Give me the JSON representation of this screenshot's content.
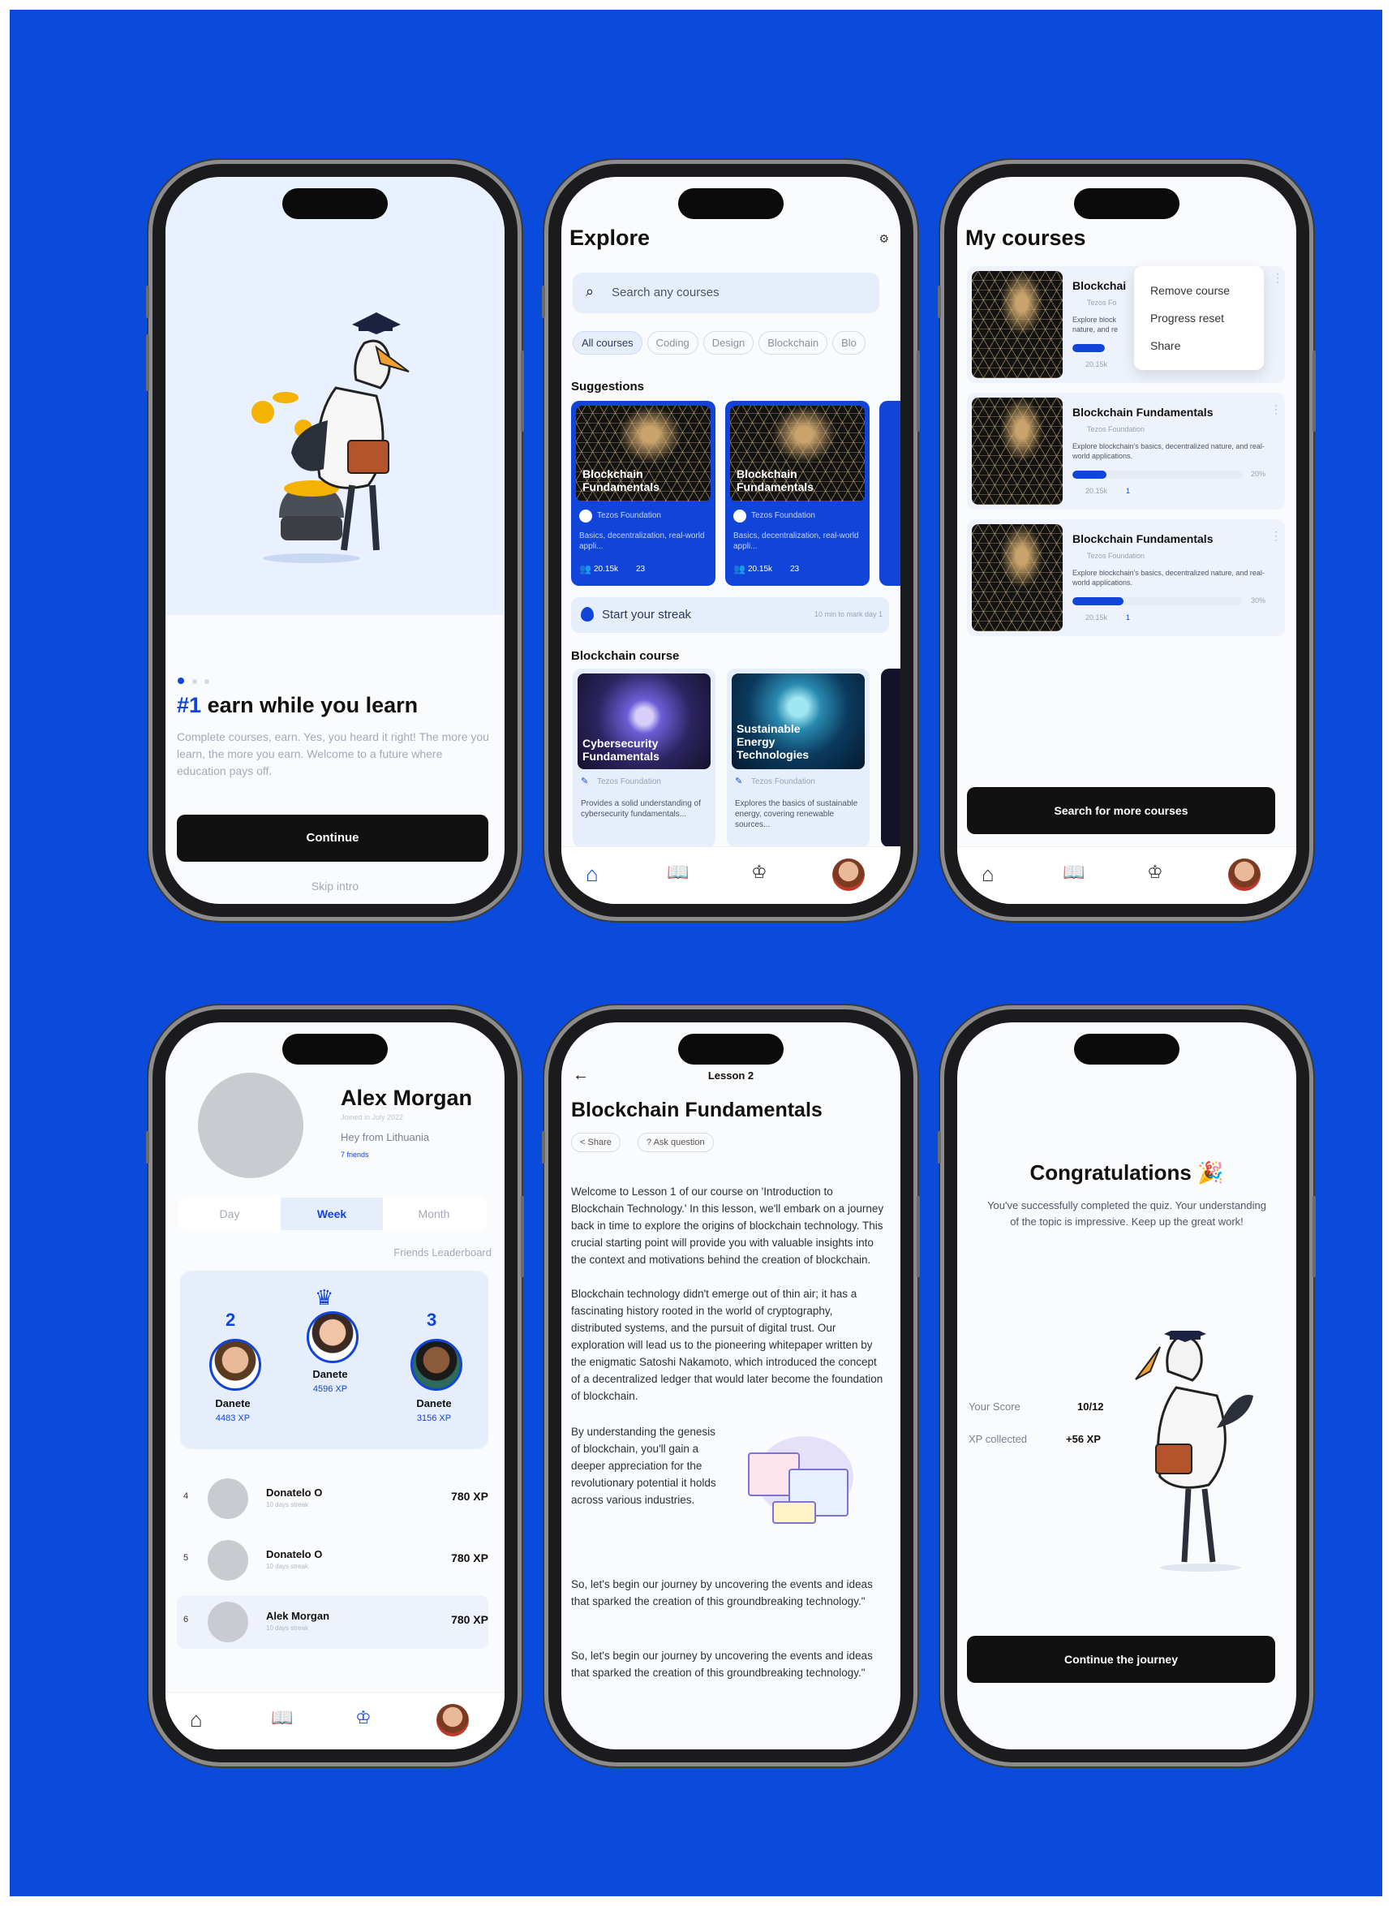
{
  "colors": {
    "background": "#0a4bdc",
    "accent": "#1145d9",
    "dark": "#111111"
  },
  "onboarding": {
    "headline_hash": "#1",
    "headline": "earn while you learn",
    "body": "Complete courses, earn. Yes, you heard it right! The more you learn, the more you earn. Welcome to a future where education pays off.",
    "continue_label": "Continue",
    "skip_label": "Skip intro"
  },
  "explore": {
    "title": "Explore",
    "search_placeholder": "Search any courses",
    "filters": [
      "All courses",
      "Coding",
      "Design",
      "Blockchain",
      "Blo"
    ],
    "suggestions_label": "Suggestions",
    "suggestion_cards": [
      {
        "title": "Blockchain Fundamentals",
        "org": "Tezos Foundation",
        "desc": "Basics, decentralization, real-world appli...",
        "learners": "20.15k",
        "count": "23"
      },
      {
        "title": "Blockchain Fundamentals",
        "org": "Tezos Foundation",
        "desc": "Basics, decentralization, real-world appli...",
        "learners": "20.15k",
        "count": "23"
      }
    ],
    "streak_label": "Start your streak",
    "streak_note": "10 min to mark day 1",
    "blockchain_course_label": "Blockchain course",
    "course_cards": [
      {
        "title": "Cybersecurity Fundamentals",
        "org": "Tezos Foundation",
        "desc": "Provides a solid understanding of cybersecurity fundamentals..."
      },
      {
        "title": "Sustainable Energy Technologies",
        "org": "Tezos Foundation",
        "desc": "Explores the basics of sustainable energy, covering renewable sources..."
      }
    ]
  },
  "my_courses": {
    "title": "My courses",
    "courses": [
      {
        "title": "Blockchai",
        "org": "Tezos Fo",
        "desc": "Explore block nature, and re",
        "progress_pct": 20,
        "pct_label": "",
        "learners": "20.15k",
        "count": "1"
      },
      {
        "title": "Blockchain Fundamentals",
        "org": "Tezos Foundation",
        "desc": "Explore blockchain's basics, decentralized nature, and real-world applications.",
        "progress_pct": 20,
        "pct_label": "20%",
        "learners": "20.15k",
        "count": "1"
      },
      {
        "title": "Blockchain Fundamentals",
        "org": "Tezos Foundation",
        "desc": "Explore blockchain's basics, decentralized nature, and real-world applications.",
        "progress_pct": 30,
        "pct_label": "30%",
        "learners": "20.15k",
        "count": "1"
      }
    ],
    "menu": [
      "Remove course",
      "Progress reset",
      "Share"
    ],
    "cta_label": "Search for more courses"
  },
  "profile": {
    "name": "Alex Morgan",
    "joined": "Joined in July 2022",
    "bio": "Hey from Lithuania",
    "friends": "7 friends",
    "tabs": [
      "Day",
      "Week",
      "Month"
    ],
    "leaderboard_label": "Friends Leaderboard",
    "podium": [
      {
        "rank": "2",
        "name": "Danete",
        "xp": "4483 XP"
      },
      {
        "rank": "",
        "name": "Danete",
        "xp": "4596 XP"
      },
      {
        "rank": "3",
        "name": "Danete",
        "xp": "3156 XP"
      }
    ],
    "rows": [
      {
        "rank": "4",
        "name": "Donatelo O",
        "sub": "10 days streak",
        "xp": "780 XP"
      },
      {
        "rank": "5",
        "name": "Donatelo O",
        "sub": "10 days streak",
        "xp": "780 XP"
      },
      {
        "rank": "6",
        "name": "Alek Morgan",
        "sub": "10 days streak",
        "xp": "780 XP"
      }
    ]
  },
  "lesson": {
    "header": "Lesson 2",
    "title": "Blockchain Fundamentals",
    "share_label": "Share",
    "ask_label": "Ask question",
    "para1": "Welcome to Lesson 1 of our course on 'Introduction to Blockchain Technology.' In this lesson, we'll embark on a journey back in time to explore the origins of blockchain technology. This crucial starting point will provide you with valuable insights into the context and motivations behind the creation of blockchain.",
    "para2": "Blockchain technology didn't emerge out of thin air; it has a fascinating history rooted in the world of cryptography, distributed systems, and the pursuit of digital trust. Our exploration will lead us to the pioneering whitepaper written by the enigmatic Satoshi Nakamoto, which introduced the concept of a decentralized ledger that would later become the foundation of blockchain.",
    "para3": "By understanding the genesis of blockchain, you'll gain a deeper appreciation for the revolutionary potential it holds across various industries.",
    "para4": "So, let's begin our journey by uncovering the events and ideas that sparked the creation of this groundbreaking technology.\"",
    "para5": "So, let's begin our journey by uncovering the events and ideas that sparked the creation of this groundbreaking technology.\""
  },
  "congrats": {
    "title": "Congratulations",
    "emoji": "🎉",
    "body": "You've successfully completed the quiz. Your understanding of the topic is impressive. Keep up the great work!",
    "score_label": "Your Score",
    "score_value": "10/12",
    "xp_label": "XP collected",
    "xp_value": "+56 XP",
    "cta_label": "Continue the journey"
  }
}
